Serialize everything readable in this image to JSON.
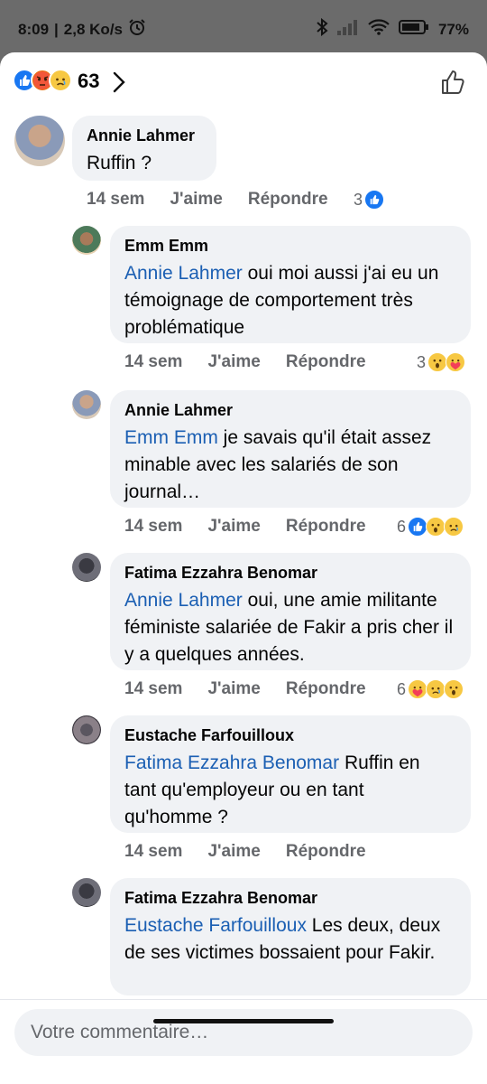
{
  "status": {
    "time": "8:09",
    "speed": "2,8 Ko/s",
    "battery": "77%"
  },
  "reactions_header": {
    "count": "63"
  },
  "comments": [
    {
      "author": "Annie Lahmer",
      "text": "Ruffin ?",
      "mention": "",
      "time": "14 sem",
      "like": "J'aime",
      "reply": "Répondre",
      "react_count": "3"
    },
    {
      "author": "Emm Emm",
      "mention": "Annie Lahmer",
      "text": " oui moi aussi j'ai eu un témoignage de comportement très problématique",
      "time": "14 sem",
      "like": "J'aime",
      "reply": "Répondre",
      "react_count": "3"
    },
    {
      "author": "Annie Lahmer",
      "mention": "Emm Emm",
      "text": " je savais qu'il était assez minable avec les salariés de son journal…",
      "time": "14 sem",
      "like": "J'aime",
      "reply": "Répondre",
      "react_count": "6"
    },
    {
      "author": "Fatima Ezzahra Benomar",
      "mention": "Annie Lahmer",
      "text": " oui, une amie militante féministe salariée de Fakir a pris cher il y a quelques années.",
      "time": "14 sem",
      "like": "J'aime",
      "reply": "Répondre",
      "react_count": "6"
    },
    {
      "author": "Eustache Farfouilloux",
      "mention": "Fatima Ezzahra Benomar",
      "text": " Ruffin en tant qu'employeur ou en tant qu'homme ?",
      "time": "14 sem",
      "like": "J'aime",
      "reply": "Répondre",
      "react_count": ""
    },
    {
      "author": "Fatima Ezzahra Benomar",
      "mention": "Eustache Farfouilloux",
      "text": " Les deux, deux de ses victimes bossaient pour Fakir.",
      "time": "",
      "like": "",
      "reply": "",
      "react_count": ""
    }
  ],
  "composer": {
    "placeholder": "Votre commentaire…"
  },
  "icons": [
    "alarm-icon",
    "bluetooth-icon",
    "signal-icon",
    "wifi-icon",
    "battery-icon",
    "like-reaction-icon",
    "angry-reaction-icon",
    "sad-reaction-icon",
    "wow-reaction-icon",
    "care-reaction-icon",
    "chevron-right-icon",
    "thumbs-up-icon"
  ],
  "colors": {
    "like_blue": "#1877f2",
    "mention_blue": "#1b5fb3",
    "bubble_bg": "#f0f2f5",
    "meta_gray": "#65676b"
  }
}
